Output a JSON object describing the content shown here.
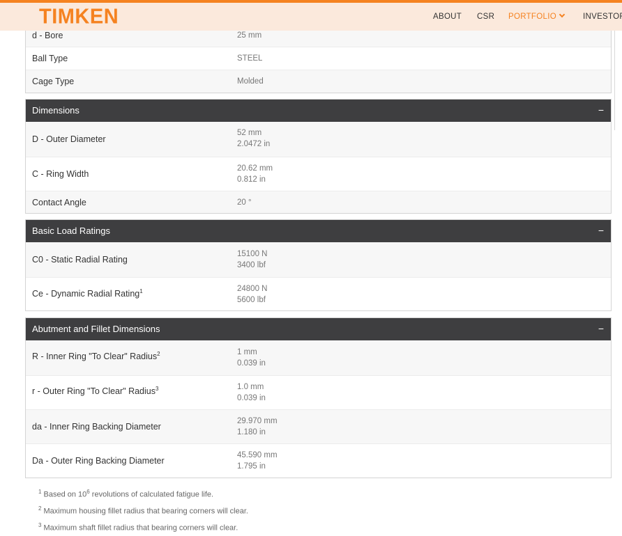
{
  "header": {
    "logo": "TIMKEN",
    "nav": {
      "about": "ABOUT",
      "csr": "CSR",
      "portfolio": "PORTFOLIO",
      "investors": "INVESTORS"
    },
    "accent_color": "#f58220"
  },
  "general": {
    "rows": [
      {
        "label": "d - Bore",
        "value1": "25 mm"
      },
      {
        "label": "Ball Type",
        "value1": "STEEL"
      },
      {
        "label": "Cage Type",
        "value1": "Molded"
      }
    ]
  },
  "dimensions": {
    "title": "Dimensions",
    "toggle": "−",
    "rows": [
      {
        "label": "D - Outer Diameter",
        "value1": "52 mm",
        "value2": "2.0472 in"
      },
      {
        "label": "C - Ring Width",
        "value1": "20.62 mm",
        "value2": "0.812 in"
      },
      {
        "label": "Contact Angle",
        "value1": "20 °"
      }
    ]
  },
  "load": {
    "title": "Basic Load Ratings",
    "toggle": "−",
    "rows": [
      {
        "label": "C0 - Static Radial Rating",
        "value1": "15100 N",
        "value2": "3400 lbf"
      },
      {
        "label": "Ce - Dynamic Radial Rating",
        "sup": "1",
        "value1": "24800 N",
        "value2": "5600 lbf"
      }
    ]
  },
  "abutment": {
    "title": "Abutment and Fillet Dimensions",
    "toggle": "−",
    "rows": [
      {
        "label": "R - Inner Ring \"To Clear\" Radius",
        "sup": "2",
        "value1": "1 mm",
        "value2": "0.039 in"
      },
      {
        "label": "r - Outer Ring \"To Clear\" Radius",
        "sup": "3",
        "value1": "1.0 mm",
        "value2": "0.039 in"
      },
      {
        "label": "da - Inner Ring Backing Diameter",
        "value1": "29.970 mm",
        "value2": "1.180 in"
      },
      {
        "label": "Da - Outer Ring Backing Diameter",
        "value1": "45.590 mm",
        "value2": "1.795 in"
      }
    ]
  },
  "footnotes": [
    {
      "num": "1",
      "text_before": "Based on 10",
      "exp": "6",
      "text_after": " revolutions of calculated fatigue life."
    },
    {
      "num": "2",
      "text_before": "Maximum housing fillet radius that bearing corners will clear."
    },
    {
      "num": "3",
      "text_before": "Maximum shaft fillet radius that bearing corners will clear."
    }
  ]
}
